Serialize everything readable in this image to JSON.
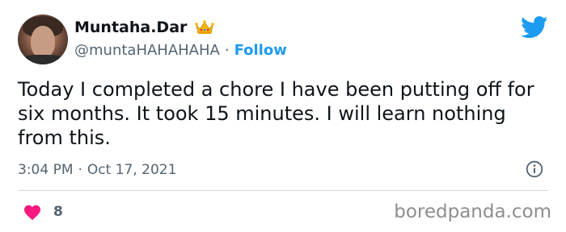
{
  "user": {
    "display_name": "Muntaha.Dar",
    "handle": "@muntaHAHAHAHA",
    "separator": "·",
    "follow_label": "Follow"
  },
  "tweet": {
    "text": "Today I completed a chore I have been putting off for six months. It took 15 minutes. I will learn nothing from this.",
    "time": "3:04 PM",
    "separator": "·",
    "date": "Oct 17, 2021",
    "like_count": "8"
  },
  "watermark": "boredpanda.com",
  "icons": {
    "crown": "crown-emoji-icon",
    "bird": "twitter-bird-icon",
    "info": "info-icon",
    "heart": "heart-icon"
  },
  "colors": {
    "accent": "#1d9bf0",
    "heart": "#f91880",
    "muted": "#536471",
    "text": "#0f1419"
  }
}
